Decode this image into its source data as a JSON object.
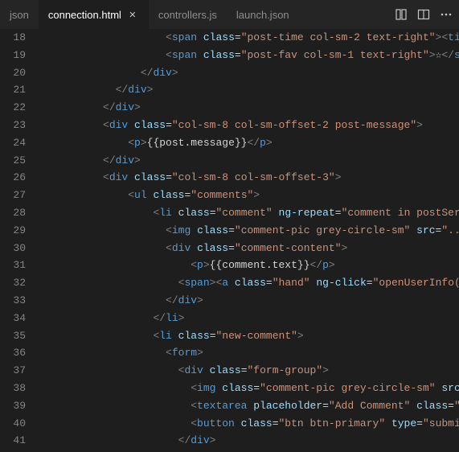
{
  "tabs": {
    "items": [
      {
        "label": "json",
        "active": false
      },
      {
        "label": "connection.html",
        "active": true
      },
      {
        "label": "controllers.js",
        "active": false
      },
      {
        "label": "launch.json",
        "active": false
      }
    ]
  },
  "gutter": {
    "start": 18,
    "end": 41
  },
  "code": {
    "lines": [
      {
        "indent": 10,
        "tokens": [
          {
            "c": "p",
            "t": "<"
          },
          {
            "c": "tg",
            "t": "span"
          },
          {
            "c": "tx",
            "t": " "
          },
          {
            "c": "at",
            "t": "class"
          },
          {
            "c": "eq",
            "t": "="
          },
          {
            "c": "st",
            "t": "\"post-time col-sm-2 text-right\""
          },
          {
            "c": "p",
            "t": "><"
          },
          {
            "c": "tg",
            "t": "ti"
          }
        ]
      },
      {
        "indent": 10,
        "tokens": [
          {
            "c": "p",
            "t": "<"
          },
          {
            "c": "tg",
            "t": "span"
          },
          {
            "c": "tx",
            "t": " "
          },
          {
            "c": "at",
            "t": "class"
          },
          {
            "c": "eq",
            "t": "="
          },
          {
            "c": "st",
            "t": "\"post-fav col-sm-1 text-right\""
          },
          {
            "c": "p",
            "t": ">"
          },
          {
            "c": "tx",
            "t": "☆"
          },
          {
            "c": "p",
            "t": "</"
          },
          {
            "c": "tg",
            "t": "s"
          }
        ]
      },
      {
        "indent": 8,
        "tokens": [
          {
            "c": "p",
            "t": "</"
          },
          {
            "c": "tg",
            "t": "div"
          },
          {
            "c": "p",
            "t": ">"
          }
        ]
      },
      {
        "indent": 6,
        "tokens": [
          {
            "c": "p",
            "t": "</"
          },
          {
            "c": "tg",
            "t": "div"
          },
          {
            "c": "p",
            "t": ">"
          }
        ]
      },
      {
        "indent": 5,
        "tokens": [
          {
            "c": "p",
            "t": "</"
          },
          {
            "c": "tg",
            "t": "div"
          },
          {
            "c": "p",
            "t": ">"
          }
        ]
      },
      {
        "indent": 5,
        "tokens": [
          {
            "c": "p",
            "t": "<"
          },
          {
            "c": "tg",
            "t": "div"
          },
          {
            "c": "tx",
            "t": " "
          },
          {
            "c": "at",
            "t": "class"
          },
          {
            "c": "eq",
            "t": "="
          },
          {
            "c": "st",
            "t": "\"col-sm-8 col-sm-offset-2 post-message\""
          },
          {
            "c": "p",
            "t": ">"
          }
        ]
      },
      {
        "indent": 7,
        "tokens": [
          {
            "c": "p",
            "t": "<"
          },
          {
            "c": "tg",
            "t": "p"
          },
          {
            "c": "p",
            "t": ">"
          },
          {
            "c": "tx",
            "t": "{{post.message}}"
          },
          {
            "c": "p",
            "t": "</"
          },
          {
            "c": "tg",
            "t": "p"
          },
          {
            "c": "p",
            "t": ">"
          }
        ]
      },
      {
        "indent": 5,
        "tokens": [
          {
            "c": "p",
            "t": "</"
          },
          {
            "c": "tg",
            "t": "div"
          },
          {
            "c": "p",
            "t": ">"
          }
        ]
      },
      {
        "indent": 5,
        "tokens": [
          {
            "c": "p",
            "t": "<"
          },
          {
            "c": "tg",
            "t": "div"
          },
          {
            "c": "tx",
            "t": " "
          },
          {
            "c": "at",
            "t": "class"
          },
          {
            "c": "eq",
            "t": "="
          },
          {
            "c": "st",
            "t": "\"col-sm-8 col-sm-offset-3\""
          },
          {
            "c": "p",
            "t": ">"
          }
        ]
      },
      {
        "indent": 7,
        "tokens": [
          {
            "c": "p",
            "t": "<"
          },
          {
            "c": "tg",
            "t": "ul"
          },
          {
            "c": "tx",
            "t": " "
          },
          {
            "c": "at",
            "t": "class"
          },
          {
            "c": "eq",
            "t": "="
          },
          {
            "c": "st",
            "t": "\"comments\""
          },
          {
            "c": "p",
            "t": ">"
          }
        ]
      },
      {
        "indent": 9,
        "tokens": [
          {
            "c": "p",
            "t": "<"
          },
          {
            "c": "tg",
            "t": "li"
          },
          {
            "c": "tx",
            "t": " "
          },
          {
            "c": "at",
            "t": "class"
          },
          {
            "c": "eq",
            "t": "="
          },
          {
            "c": "st",
            "t": "\"comment\""
          },
          {
            "c": "tx",
            "t": " "
          },
          {
            "c": "at",
            "t": "ng-repeat"
          },
          {
            "c": "eq",
            "t": "="
          },
          {
            "c": "st",
            "t": "\"comment in postSer"
          }
        ]
      },
      {
        "indent": 10,
        "tokens": [
          {
            "c": "p",
            "t": "<"
          },
          {
            "c": "tg",
            "t": "img"
          },
          {
            "c": "tx",
            "t": " "
          },
          {
            "c": "at",
            "t": "class"
          },
          {
            "c": "eq",
            "t": "="
          },
          {
            "c": "st",
            "t": "\"comment-pic grey-circle-sm\""
          },
          {
            "c": "tx",
            "t": " "
          },
          {
            "c": "at",
            "t": "src"
          },
          {
            "c": "eq",
            "t": "="
          },
          {
            "c": "st",
            "t": "\"..."
          }
        ]
      },
      {
        "indent": 10,
        "tokens": [
          {
            "c": "p",
            "t": "<"
          },
          {
            "c": "tg",
            "t": "div"
          },
          {
            "c": "tx",
            "t": " "
          },
          {
            "c": "at",
            "t": "class"
          },
          {
            "c": "eq",
            "t": "="
          },
          {
            "c": "st",
            "t": "\"comment-content\""
          },
          {
            "c": "p",
            "t": ">"
          }
        ]
      },
      {
        "indent": 12,
        "tokens": [
          {
            "c": "p",
            "t": "<"
          },
          {
            "c": "tg",
            "t": "p"
          },
          {
            "c": "p",
            "t": ">"
          },
          {
            "c": "tx",
            "t": "{{comment.text}}"
          },
          {
            "c": "p",
            "t": "</"
          },
          {
            "c": "tg",
            "t": "p"
          },
          {
            "c": "p",
            "t": ">"
          }
        ]
      },
      {
        "indent": 11,
        "tokens": [
          {
            "c": "p",
            "t": "<"
          },
          {
            "c": "tg",
            "t": "span"
          },
          {
            "c": "p",
            "t": "><"
          },
          {
            "c": "tg",
            "t": "a"
          },
          {
            "c": "tx",
            "t": " "
          },
          {
            "c": "at",
            "t": "class"
          },
          {
            "c": "eq",
            "t": "="
          },
          {
            "c": "st",
            "t": "\"hand\""
          },
          {
            "c": "tx",
            "t": " "
          },
          {
            "c": "at",
            "t": "ng-click"
          },
          {
            "c": "eq",
            "t": "="
          },
          {
            "c": "st",
            "t": "\"openUserInfo("
          }
        ]
      },
      {
        "indent": 10,
        "tokens": [
          {
            "c": "p",
            "t": "</"
          },
          {
            "c": "tg",
            "t": "div"
          },
          {
            "c": "p",
            "t": ">"
          }
        ]
      },
      {
        "indent": 9,
        "tokens": [
          {
            "c": "p",
            "t": "</"
          },
          {
            "c": "tg",
            "t": "li"
          },
          {
            "c": "p",
            "t": ">"
          }
        ]
      },
      {
        "indent": 9,
        "tokens": [
          {
            "c": "p",
            "t": "<"
          },
          {
            "c": "tg",
            "t": "li"
          },
          {
            "c": "tx",
            "t": " "
          },
          {
            "c": "at",
            "t": "class"
          },
          {
            "c": "eq",
            "t": "="
          },
          {
            "c": "st",
            "t": "\"new-comment\""
          },
          {
            "c": "p",
            "t": ">"
          }
        ]
      },
      {
        "indent": 10,
        "tokens": [
          {
            "c": "p",
            "t": "<"
          },
          {
            "c": "tg",
            "t": "form"
          },
          {
            "c": "p",
            "t": ">"
          }
        ]
      },
      {
        "indent": 11,
        "tokens": [
          {
            "c": "p",
            "t": "<"
          },
          {
            "c": "tg",
            "t": "div"
          },
          {
            "c": "tx",
            "t": " "
          },
          {
            "c": "at",
            "t": "class"
          },
          {
            "c": "eq",
            "t": "="
          },
          {
            "c": "st",
            "t": "\"form-group\""
          },
          {
            "c": "p",
            "t": ">"
          }
        ]
      },
      {
        "indent": 12,
        "tokens": [
          {
            "c": "p",
            "t": "<"
          },
          {
            "c": "tg",
            "t": "img"
          },
          {
            "c": "tx",
            "t": " "
          },
          {
            "c": "at",
            "t": "class"
          },
          {
            "c": "eq",
            "t": "="
          },
          {
            "c": "st",
            "t": "\"comment-pic grey-circle-sm\""
          },
          {
            "c": "tx",
            "t": " "
          },
          {
            "c": "at",
            "t": "src"
          }
        ]
      },
      {
        "indent": 12,
        "tokens": [
          {
            "c": "p",
            "t": "<"
          },
          {
            "c": "tg",
            "t": "textarea"
          },
          {
            "c": "tx",
            "t": " "
          },
          {
            "c": "at",
            "t": "placeholder"
          },
          {
            "c": "eq",
            "t": "="
          },
          {
            "c": "st",
            "t": "\"Add Comment\""
          },
          {
            "c": "tx",
            "t": " "
          },
          {
            "c": "at",
            "t": "class"
          },
          {
            "c": "eq",
            "t": "="
          },
          {
            "c": "st",
            "t": "\""
          }
        ]
      },
      {
        "indent": 12,
        "tokens": [
          {
            "c": "p",
            "t": "<"
          },
          {
            "c": "tg",
            "t": "button"
          },
          {
            "c": "tx",
            "t": " "
          },
          {
            "c": "at",
            "t": "class"
          },
          {
            "c": "eq",
            "t": "="
          },
          {
            "c": "st",
            "t": "\"btn btn-primary\""
          },
          {
            "c": "tx",
            "t": " "
          },
          {
            "c": "at",
            "t": "type"
          },
          {
            "c": "eq",
            "t": "="
          },
          {
            "c": "st",
            "t": "\"submi"
          }
        ]
      },
      {
        "indent": 11,
        "tokens": [
          {
            "c": "p",
            "t": "</"
          },
          {
            "c": "tg",
            "t": "div"
          },
          {
            "c": "p",
            "t": ">"
          }
        ]
      }
    ]
  }
}
